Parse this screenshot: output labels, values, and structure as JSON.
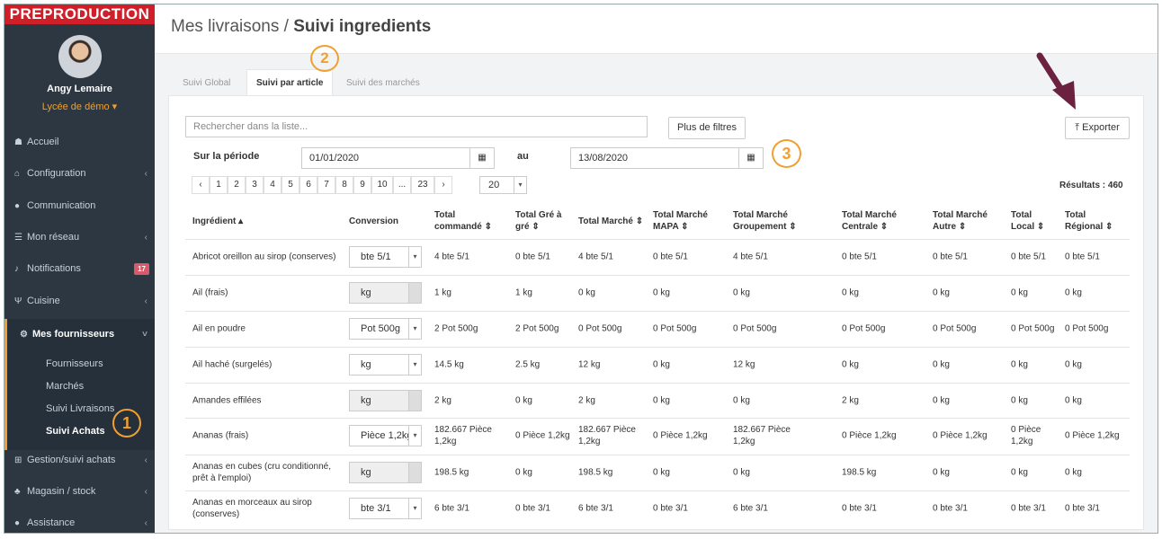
{
  "env_banner": "PREPRODUCTION",
  "user": {
    "name": "Angy Lemaire",
    "school": "Lycée de démo ▾"
  },
  "nav": [
    {
      "icon": "☗",
      "label": "Accueil",
      "chevron": ""
    },
    {
      "icon": "⌂",
      "label": "Configuration",
      "chevron": "‹"
    },
    {
      "icon": "●",
      "label": "Communication",
      "chevron": ""
    },
    {
      "icon": "☰",
      "label": "Mon réseau",
      "chevron": "‹"
    },
    {
      "icon": "♪",
      "label": "Notifications",
      "chevron": ""
    },
    {
      "icon": "Ψ",
      "label": "Cuisine",
      "chevron": "‹"
    },
    {
      "icon": "⚙",
      "label": "Mes fournisseurs",
      "chevron": "˅"
    },
    {
      "icon": "⊞",
      "label": "Gestion/suivi achats",
      "chevron": "‹"
    },
    {
      "icon": "♣",
      "label": "Magasin / stock",
      "chevron": "‹"
    },
    {
      "icon": "●",
      "label": "Assistance",
      "chevron": "‹"
    }
  ],
  "notifications_badge": "17",
  "subnav": [
    "Fournisseurs",
    "Marchés",
    "Suivi Livraisons",
    "Suivi Achats"
  ],
  "page": {
    "title_prefix": "Mes livraisons / ",
    "title_bold": "Suivi ingredients"
  },
  "tabs": [
    "Suivi Global",
    "Suivi par article",
    "Suivi des marchés"
  ],
  "search": {
    "placeholder": "Rechercher dans la liste..."
  },
  "more_filters": "Plus de filtres",
  "export": "⤒ Exporter",
  "period": {
    "label": "Sur la période",
    "from": "01/01/2020",
    "to_label": "au",
    "to": "13/08/2020"
  },
  "pagination": [
    "‹",
    "1",
    "2",
    "3",
    "4",
    "5",
    "6",
    "7",
    "8",
    "9",
    "10",
    "...",
    "23",
    "›"
  ],
  "page_size": "20",
  "results": "Résultats : 460",
  "callouts": [
    "1",
    "2",
    "3"
  ],
  "columns": [
    "Ingrédient ▴",
    "Conversion",
    "Total commandé ⇕",
    "Total Gré à gré ⇕",
    "Total Marché ⇕",
    "Total Marché MAPA ⇕",
    "Total Marché Groupement ⇕",
    "Total Marché Centrale ⇕",
    "Total Marché Autre ⇕",
    "Total Local ⇕",
    "Total Régional ⇕"
  ],
  "rows": [
    {
      "name": "Abricot oreillon au sirop (conserves)",
      "conv": "bte 5/1",
      "disabled": false,
      "vals": [
        "4 bte 5/1",
        "0 bte 5/1",
        "4 bte 5/1",
        "0 bte 5/1",
        "4 bte 5/1",
        "0 bte 5/1",
        "0 bte 5/1",
        "0 bte 5/1",
        "0 bte 5/1"
      ]
    },
    {
      "name": "Ail (frais)",
      "conv": "kg",
      "disabled": true,
      "vals": [
        "1 kg",
        "1 kg",
        "0 kg",
        "0 kg",
        "0 kg",
        "0 kg",
        "0 kg",
        "0 kg",
        "0 kg"
      ]
    },
    {
      "name": "Ail en poudre",
      "conv": "Pot 500g",
      "disabled": false,
      "vals": [
        "2 Pot 500g",
        "2 Pot 500g",
        "0 Pot 500g",
        "0 Pot 500g",
        "0 Pot 500g",
        "0 Pot 500g",
        "0 Pot 500g",
        "0 Pot 500g",
        "0 Pot 500g"
      ]
    },
    {
      "name": "Ail haché (surgelés)",
      "conv": "kg",
      "disabled": false,
      "vals": [
        "14.5 kg",
        "2.5 kg",
        "12 kg",
        "0 kg",
        "12 kg",
        "0 kg",
        "0 kg",
        "0 kg",
        "0 kg"
      ]
    },
    {
      "name": "Amandes effilées",
      "conv": "kg",
      "disabled": true,
      "vals": [
        "2 kg",
        "0 kg",
        "2 kg",
        "0 kg",
        "0 kg",
        "2 kg",
        "0 kg",
        "0 kg",
        "0 kg"
      ]
    },
    {
      "name": "Ananas (frais)",
      "conv": "Pièce 1,2kg",
      "disabled": false,
      "vals": [
        "182.667 Pièce 1,2kg",
        "0 Pièce 1,2kg",
        "182.667 Pièce 1,2kg",
        "0 Pièce 1,2kg",
        "182.667 Pièce 1,2kg",
        "0 Pièce 1,2kg",
        "0 Pièce 1,2kg",
        "0 Pièce 1,2kg",
        "0 Pièce 1,2kg"
      ]
    },
    {
      "name": "Ananas en cubes (cru conditionné, prêt à l'emploi)",
      "conv": "kg",
      "disabled": true,
      "vals": [
        "198.5 kg",
        "0 kg",
        "198.5 kg",
        "0 kg",
        "0 kg",
        "198.5 kg",
        "0 kg",
        "0 kg",
        "0 kg"
      ]
    },
    {
      "name": "Ananas en morceaux au sirop (conserves)",
      "conv": "bte 3/1",
      "disabled": false,
      "vals": [
        "6 bte 3/1",
        "0 bte 3/1",
        "6 bte 3/1",
        "0 bte 3/1",
        "6 bte 3/1",
        "0 bte 3/1",
        "0 bte 3/1",
        "0 bte 3/1",
        "0 bte 3/1"
      ]
    }
  ],
  "colors": {
    "sidebar": "#2d3742",
    "accent": "#f0a030",
    "banner": "#d11f2a",
    "arrow": "#6b2240"
  }
}
